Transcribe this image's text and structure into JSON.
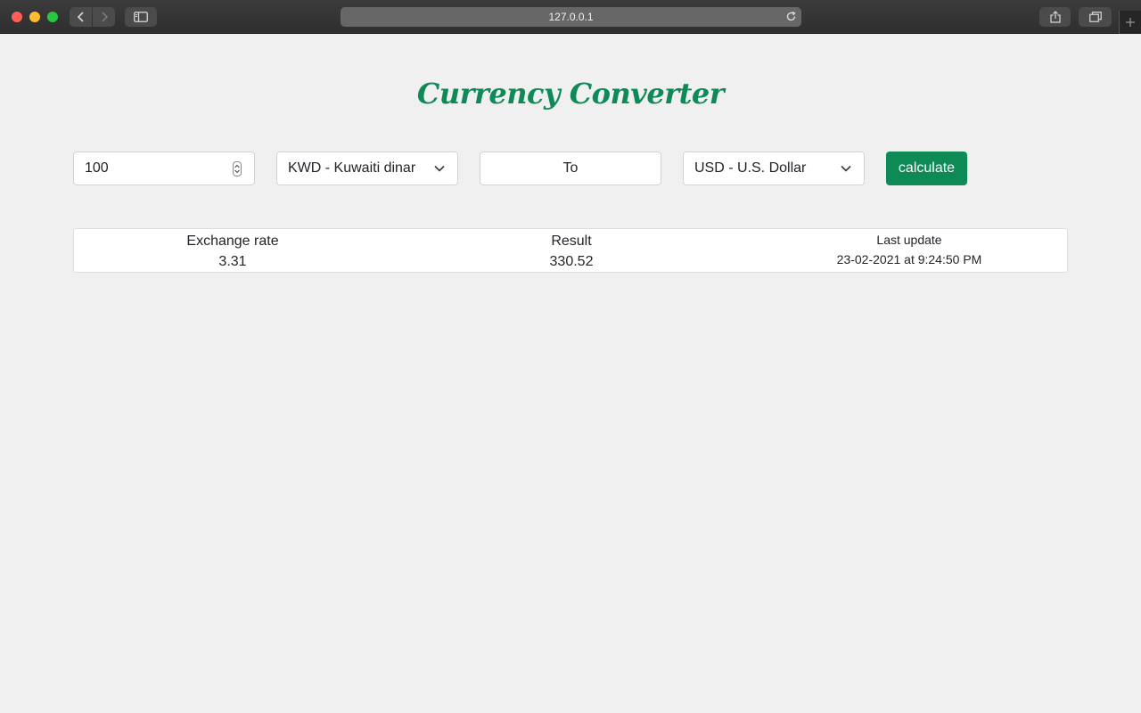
{
  "browser": {
    "url": "127.0.0.1"
  },
  "page": {
    "title": "Currency Converter"
  },
  "form": {
    "amount": "100",
    "from_currency": "KWD - Kuwaiti dinar",
    "to_label": "To",
    "to_currency": "USD - U.S. Dollar",
    "calculate_label": "calculate"
  },
  "results": {
    "exchange_rate_label": "Exchange rate",
    "exchange_rate_value": "3.31",
    "result_label": "Result",
    "result_value": "330.52",
    "last_update_label": "Last update",
    "last_update_value": "23-02-2021 at 9:24:50 PM"
  },
  "colors": {
    "accent": "#0e8a57",
    "page_background": "#f0f0f0"
  },
  "icons": [
    "back-icon",
    "forward-icon",
    "sidebar-icon",
    "reload-icon",
    "share-icon",
    "tabs-icon",
    "plus-icon",
    "chevron-down-icon",
    "stepper-icon"
  ]
}
